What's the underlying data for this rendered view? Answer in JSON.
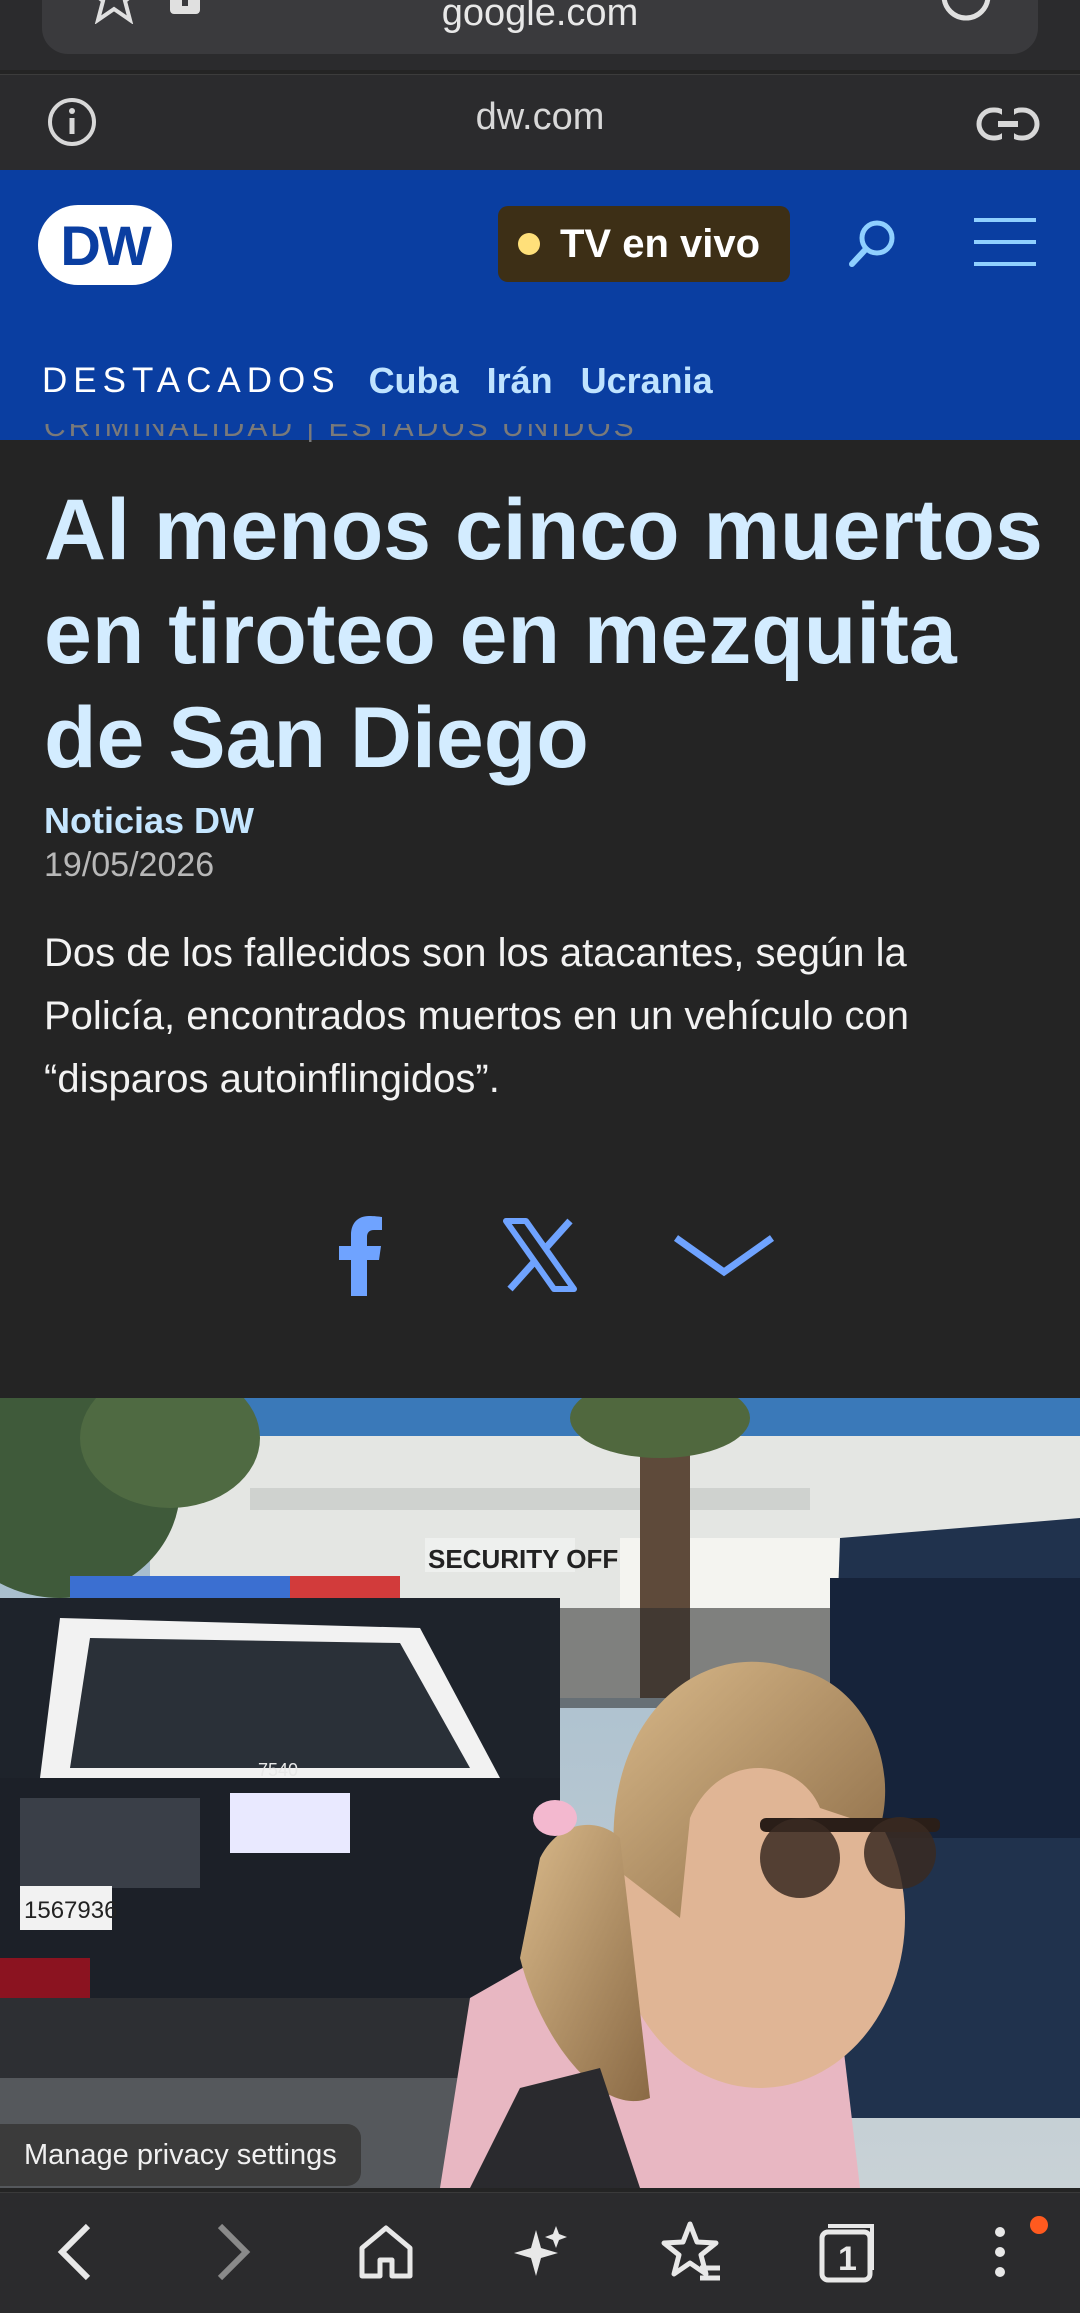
{
  "browser": {
    "omnibox_domain": "google.com",
    "site_domain": "dw.com"
  },
  "header": {
    "logo": "DW",
    "tv_button": "TV en vivo",
    "nav_heading": "DESTACADOS",
    "nav_links": [
      "Cuba",
      "Irán",
      "Ucrania"
    ]
  },
  "article": {
    "category": "CRIMINALIDAD | ESTADOS UNIDOS",
    "headline": "Al menos cinco muertos en tiroteo en mezquita de San Diego",
    "author": "Noticias DW",
    "date": "19/05/2026",
    "teaser": "Dos de los fallecidos son los atacantes, según la Policía, encontrados muertos en un vehículo con “disparos autoinflingidos”."
  },
  "share": {
    "icons": [
      "facebook-icon",
      "x-icon",
      "chevron-down-icon"
    ]
  },
  "photo": {
    "sign_text": "SECURITY OFF",
    "license_plate": "1567936",
    "car_number": "7540"
  },
  "privacy_button": "Manage privacy settings",
  "toolbar": {
    "tab_count": "1",
    "icons": [
      "back-icon",
      "forward-icon",
      "home-icon",
      "ai-sparkle-icon",
      "bookmark-star-icon",
      "tabs-icon",
      "menu-icon"
    ]
  },
  "colors": {
    "dw_blue": "#0a3ea1",
    "headline": "#d3ecff",
    "link": "#bfe3ff",
    "tv_dot": "#ffe07a",
    "notify_dot": "#ff5a1f"
  }
}
